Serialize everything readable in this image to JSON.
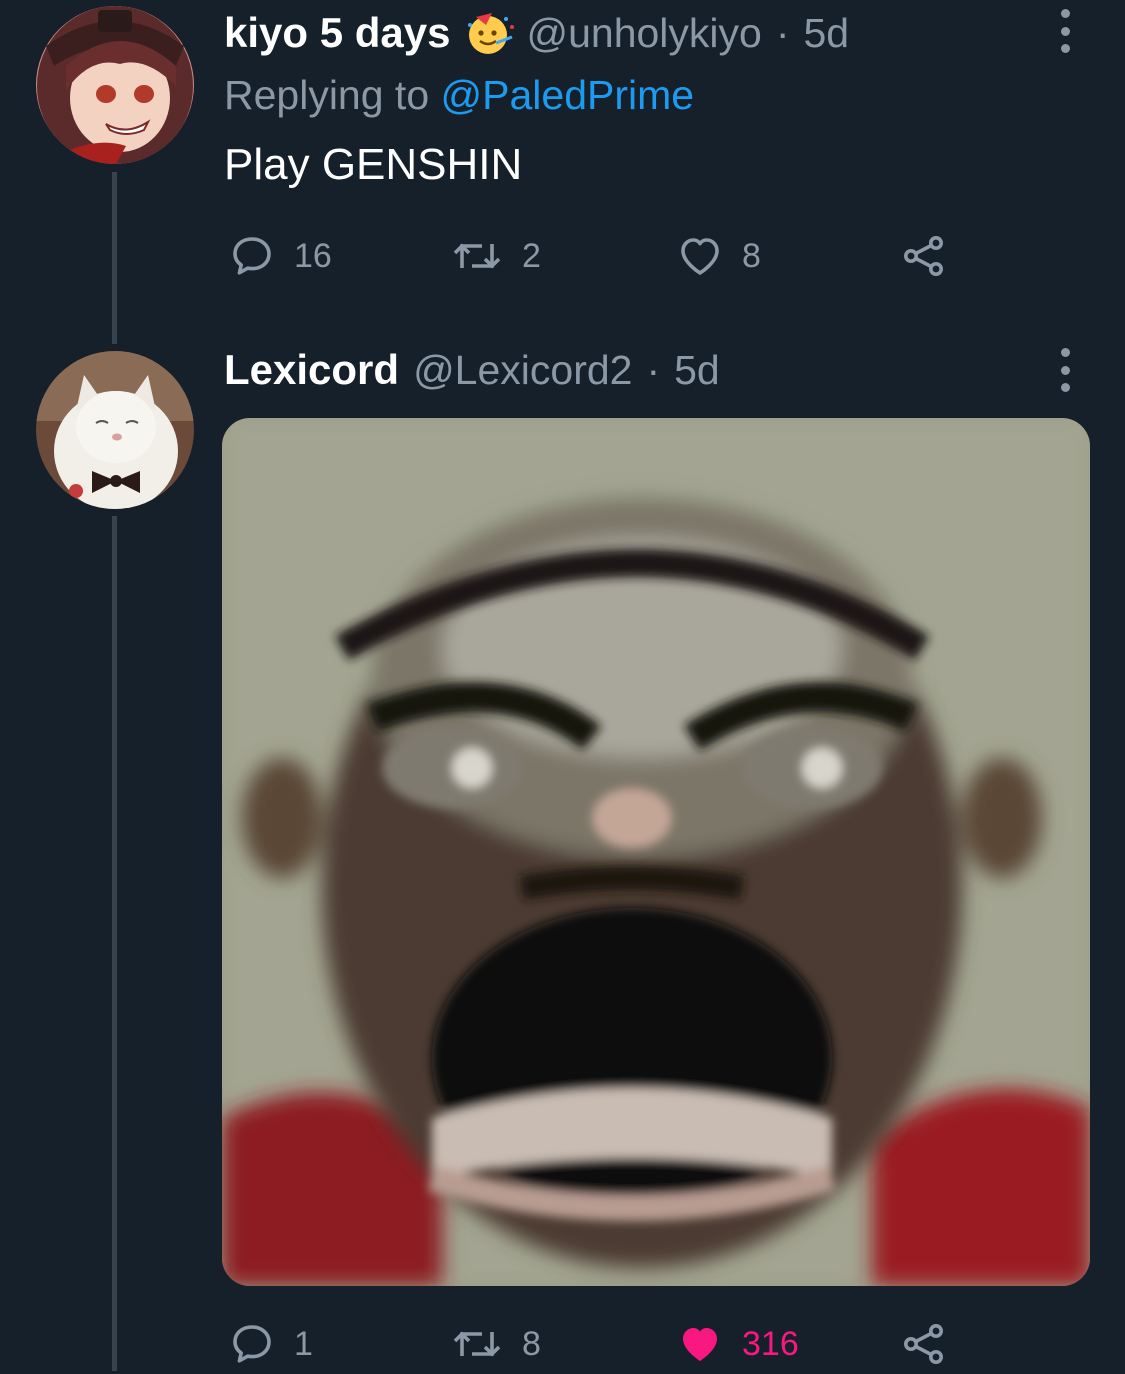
{
  "tweets": [
    {
      "display_name": "kiyo 5 days",
      "handle": "@unholykiyo",
      "separator": "·",
      "time": "5d",
      "reply_prefix": "Replying to",
      "reply_to": "@PaledPrime",
      "text": "Play GENSHIN",
      "replies": "16",
      "retweets": "2",
      "likes": "8",
      "liked": false,
      "avatar": "anime-girl-avatar",
      "emoji": "party-face-emoji"
    },
    {
      "display_name": "Lexicord",
      "handle": "@Lexicord2",
      "separator": "·",
      "time": "5d",
      "replies": "1",
      "retweets": "8",
      "likes": "316",
      "liked": true,
      "avatar": "white-cat-avatar",
      "media": "blurry-screaming-face-image"
    }
  ],
  "colors": {
    "background": "#15202b",
    "secondary_text": "#8b98a5",
    "link": "#1d9bf0",
    "like_active": "#f91880",
    "thread_line": "#38444d"
  }
}
